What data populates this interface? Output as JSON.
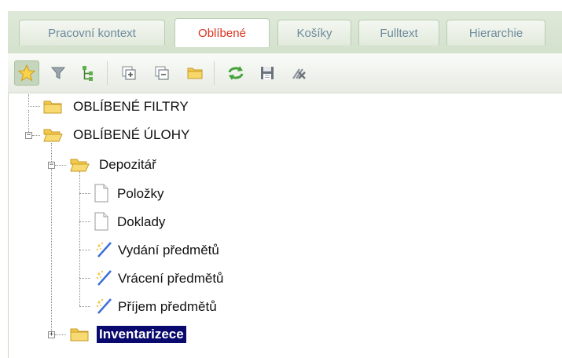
{
  "tabs": [
    {
      "label": "Pracovní kontext",
      "active": false
    },
    {
      "label": "Oblíbené",
      "active": true
    },
    {
      "label": "Košíky",
      "active": false
    },
    {
      "label": "Fulltext",
      "active": false
    },
    {
      "label": "Hierarchie",
      "active": false
    }
  ],
  "toolbar": {
    "buttons": [
      {
        "icon": "star-icon",
        "active": true
      },
      {
        "icon": "filter-icon"
      },
      {
        "icon": "tree-icon"
      },
      {
        "icon": "expand-all-icon"
      },
      {
        "icon": "collapse-all-icon"
      },
      {
        "icon": "folder-icon"
      },
      {
        "icon": "refresh-icon"
      },
      {
        "icon": "save-icon"
      },
      {
        "icon": "delete-icon"
      }
    ]
  },
  "tree": {
    "nodes": [
      {
        "label": "OBLÍBENÉ FILTRY",
        "type": "folder",
        "level": 0
      },
      {
        "label": "OBLÍBENÉ ÚLOHY",
        "type": "folder-open",
        "level": 0,
        "expanded": true
      },
      {
        "label": "Depozitář",
        "type": "folder-open",
        "level": 1,
        "expanded": true
      },
      {
        "label": "Položky",
        "type": "document",
        "level": 2
      },
      {
        "label": "Doklady",
        "type": "document",
        "level": 2
      },
      {
        "label": "Vydání předmětů",
        "type": "wand",
        "level": 2
      },
      {
        "label": "Vrácení předmětů",
        "type": "wand",
        "level": 2
      },
      {
        "label": "Příjem předmětů",
        "type": "wand",
        "level": 2
      },
      {
        "label": "Inventarizece",
        "type": "folder",
        "level": 1,
        "expanded": false,
        "selected": true
      }
    ]
  },
  "colors": {
    "active_tab_text": "#d9321f",
    "tab_text": "#6d8a9c",
    "selection_bg": "#0a0a6e",
    "folder": "#f2c94c"
  }
}
